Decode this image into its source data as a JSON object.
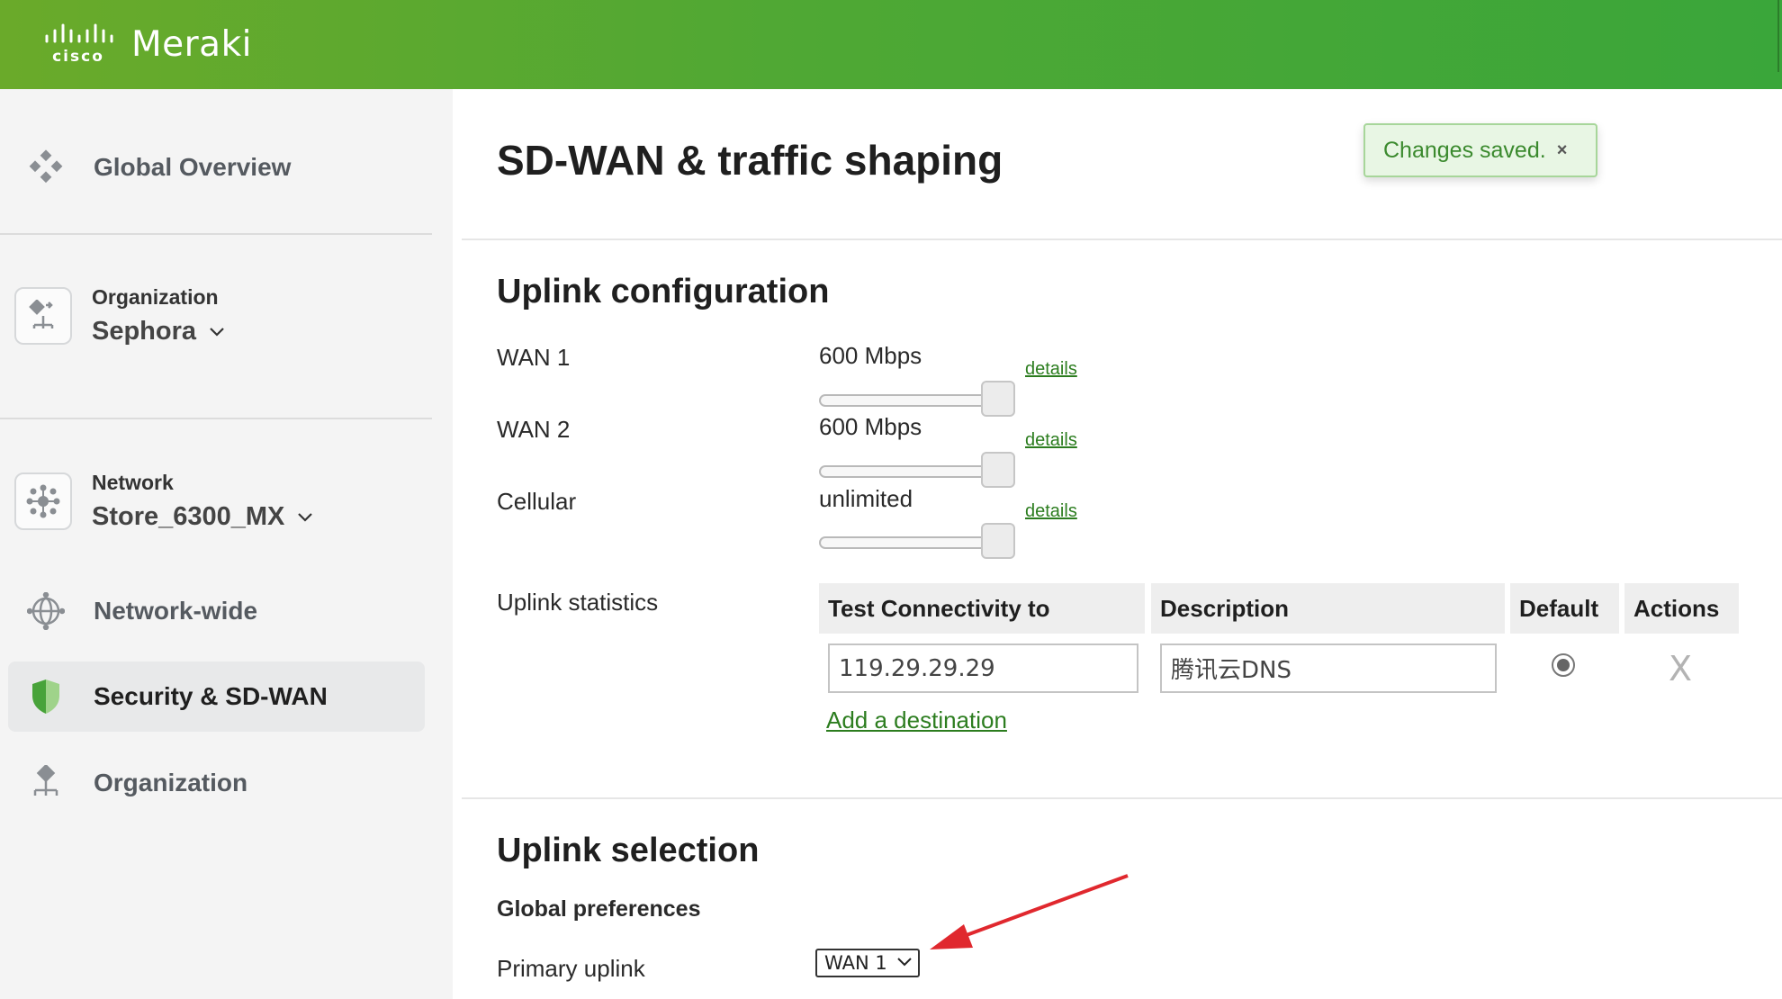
{
  "app": {
    "brand_company": "cisco",
    "brand_product": "Meraki",
    "header_gradient": [
      "#6aaa2a",
      "#3aa63a"
    ]
  },
  "sidebar": {
    "global_overview": "Global Overview",
    "organization": {
      "caption": "Organization",
      "value": "Sephora"
    },
    "network": {
      "caption": "Network",
      "value": "Store_6300_MX"
    },
    "items": [
      {
        "label": "Network-wide",
        "icon": "globe-icon"
      },
      {
        "label": "Security & SD-WAN",
        "icon": "shield-icon",
        "active": true
      },
      {
        "label": "Organization",
        "icon": "organization-icon"
      }
    ]
  },
  "page": {
    "title": "SD-WAN & traffic shaping",
    "toast": {
      "text": "Changes saved.",
      "close": "×"
    }
  },
  "uplink_config": {
    "title": "Uplink configuration",
    "uplinks": [
      {
        "label": "WAN 1",
        "speed": "600 Mbps",
        "details": "details"
      },
      {
        "label": "WAN 2",
        "speed": "600 Mbps",
        "details": "details"
      },
      {
        "label": "Cellular",
        "speed": "unlimited",
        "details": "details"
      }
    ],
    "statistics": {
      "label": "Uplink statistics",
      "columns": [
        "Test Connectivity to",
        "Description",
        "Default",
        "Actions"
      ],
      "rows": [
        {
          "destination": "119.29.29.29",
          "description": "腾讯云DNS",
          "default": true,
          "action": "X"
        }
      ],
      "add_link": "Add a destination"
    }
  },
  "uplink_selection": {
    "title": "Uplink selection",
    "subtitle": "Global preferences",
    "primary_label": "Primary uplink",
    "primary_value": "WAN 1"
  },
  "colors": {
    "accent": "#3aa63a",
    "link": "#2c7d1f",
    "annotation_arrow": "#e0282e"
  }
}
